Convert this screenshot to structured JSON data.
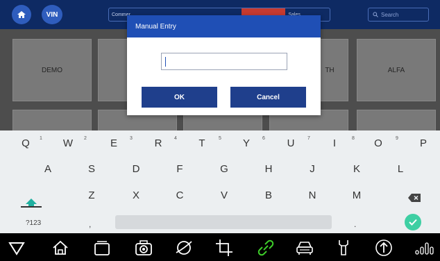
{
  "topbar": {
    "vin_label": "VIN",
    "tabs": [
      "Commer",
      "",
      "",
      "",
      "Sales",
      ""
    ],
    "search_placeholder": "Search",
    "accent_color": "#c63a30"
  },
  "tiles": {
    "left_label": "DEMO",
    "right_label": "ALFA",
    "partial_label": "TH"
  },
  "dialog": {
    "title": "Manual Entry",
    "input_value": "",
    "ok_label": "OK",
    "cancel_label": "Cancel",
    "header_color": "#1f4fb5"
  },
  "keyboard": {
    "row1": [
      "Q",
      "W",
      "E",
      "R",
      "T",
      "Y",
      "U",
      "I",
      "O",
      "P"
    ],
    "row1_numbers": [
      "1",
      "2",
      "3",
      "4",
      "5",
      "6",
      "7",
      "8",
      "9"
    ],
    "row2": [
      "A",
      "S",
      "D",
      "F",
      "G",
      "H",
      "J",
      "K",
      "L"
    ],
    "row3": [
      "Z",
      "X",
      "C",
      "V",
      "B",
      "N",
      "M"
    ],
    "symbols_label": "?123",
    "comma": ",",
    "period": ".",
    "done_color": "#3ecfa3"
  },
  "navbar": {
    "icons": [
      "back-icon",
      "home-icon",
      "recents-icon",
      "camera-icon",
      "browser-icon",
      "crop-icon",
      "link-icon",
      "car-icon",
      "wrench-icon",
      "upload-icon",
      "signal-icon"
    ],
    "active_color": "#3ecf2a"
  }
}
